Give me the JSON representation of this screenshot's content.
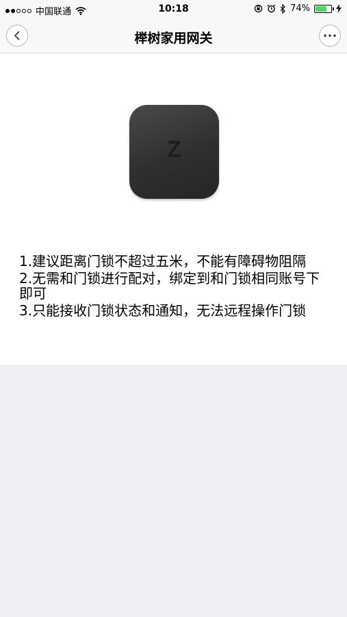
{
  "status_bar": {
    "carrier": "中国联通",
    "time": "10:18",
    "battery": "74%",
    "battery_level": 0.74
  },
  "nav": {
    "title": "榉树家用网关",
    "back_icon": "chevron-left-icon",
    "more_icon": "more-dots-icon"
  },
  "device": {
    "letter": "Z"
  },
  "tips": [
    "1.建议距离门锁不超过五米，不能有障碍物阻隔",
    "2.无需和门锁进行配对，绑定到和门锁相同账号下即可",
    "3.只能接收门锁状态和通知，无法远程操作门锁"
  ],
  "colors": {
    "battery_fill": "#4cd964",
    "background": "#efeff4"
  }
}
